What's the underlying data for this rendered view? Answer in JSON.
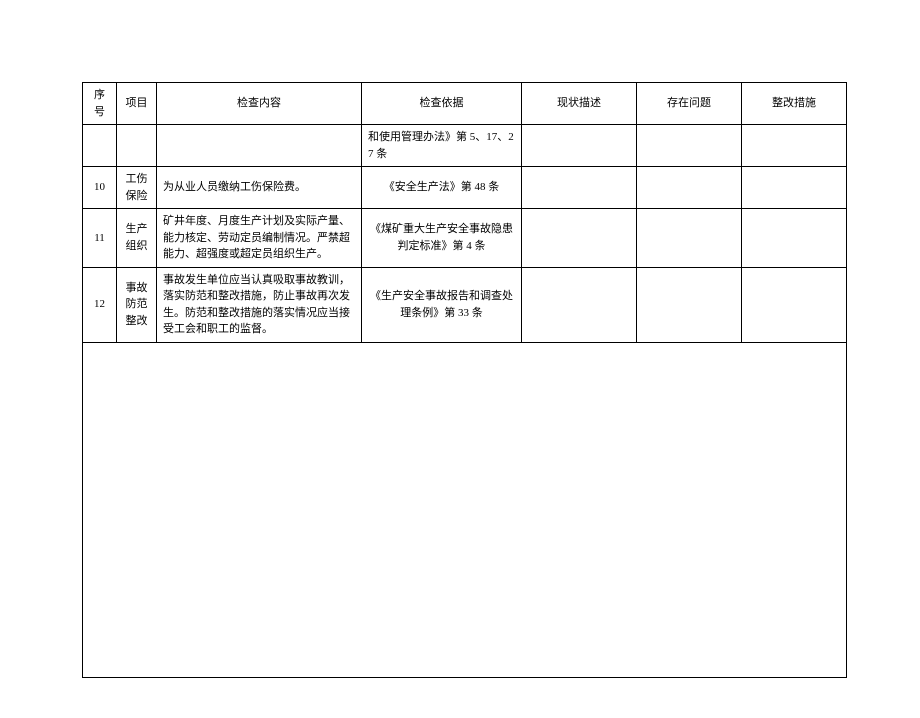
{
  "headers": {
    "seq": "序号",
    "item": "项目",
    "content": "检查内容",
    "basis": "检查依据",
    "status": "现状描述",
    "problem": "存在问题",
    "action": "整改措施"
  },
  "rows": [
    {
      "seq": "",
      "item": "",
      "content": "",
      "basis": "和使用管理办法》第 5、17、27 条",
      "status": "",
      "problem": "",
      "action": ""
    },
    {
      "seq": "10",
      "item": "工伤保险",
      "content": "为从业人员缴纳工伤保险费。",
      "basis": "《安全生产法》第 48 条",
      "status": "",
      "problem": "",
      "action": ""
    },
    {
      "seq": "11",
      "item": "生产组织",
      "content": "矿井年度、月度生产计划及实际产量、能力核定、劳动定员编制情况。严禁超能力、超强度或超定员组织生产。",
      "basis": "《煤矿重大生产安全事故隐患判定标准》第 4 条",
      "status": "",
      "problem": "",
      "action": ""
    },
    {
      "seq": "12",
      "item": "事故防范整改",
      "content": "事故发生单位应当认真吸取事故教训，落实防范和整改措施，防止事故再次发生。防范和整改措施的落实情况应当接受工会和职工的监督。",
      "basis": "《生产安全事故报告和调查处理条例》第 33 条",
      "status": "",
      "problem": "",
      "action": ""
    }
  ]
}
